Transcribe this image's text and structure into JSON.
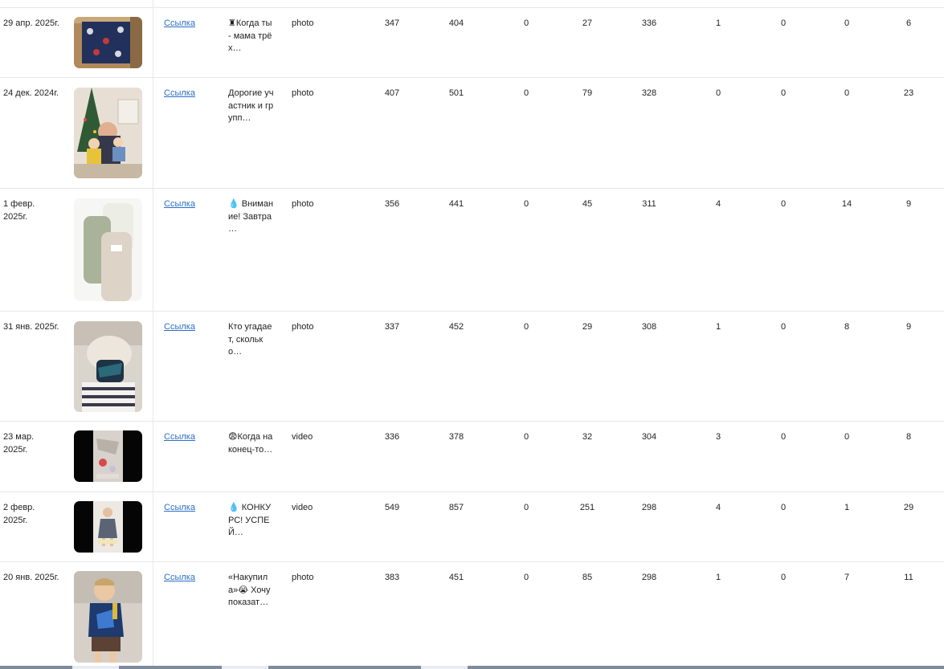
{
  "link_label": "Ссылка",
  "rows": [
    {
      "date": "29 апр. 2025г.",
      "text": "♜Когда ты - мама трёх…",
      "type": "photo",
      "values": [
        "347",
        "404",
        "0",
        "27",
        "336",
        "1",
        "0",
        "0",
        "6"
      ]
    },
    {
      "date": "24 дек. 2024г.",
      "text": "Дорогие участник и групп…",
      "type": "photo",
      "values": [
        "407",
        "501",
        "0",
        "79",
        "328",
        "0",
        "0",
        "0",
        "23"
      ]
    },
    {
      "date": "1 февр. 2025г.",
      "text": "💧 Внимание! Завтра …",
      "type": "photo",
      "values": [
        "356",
        "441",
        "0",
        "45",
        "311",
        "4",
        "0",
        "14",
        "9"
      ]
    },
    {
      "date": "31 янв. 2025г.",
      "text": "Кто угадает, сколько…",
      "type": "photo",
      "values": [
        "337",
        "452",
        "0",
        "29",
        "308",
        "1",
        "0",
        "8",
        "9"
      ]
    },
    {
      "date": "23 мар. 2025г.",
      "text": "😨Когда наконец-то…",
      "type": "video",
      "values": [
        "336",
        "378",
        "0",
        "32",
        "304",
        "3",
        "0",
        "0",
        "8"
      ]
    },
    {
      "date": "2 февр. 2025г.",
      "text": "💧 КОНКУРС! УСПЕЙ…",
      "type": "video",
      "values": [
        "549",
        "857",
        "0",
        "251",
        "298",
        "4",
        "0",
        "1",
        "29"
      ]
    },
    {
      "date": "20 янв. 2025г.",
      "text": "«Накупила»😭 Хочу показат…",
      "type": "photo",
      "values": [
        "383",
        "451",
        "0",
        "85",
        "298",
        "1",
        "0",
        "7",
        "11"
      ]
    }
  ]
}
